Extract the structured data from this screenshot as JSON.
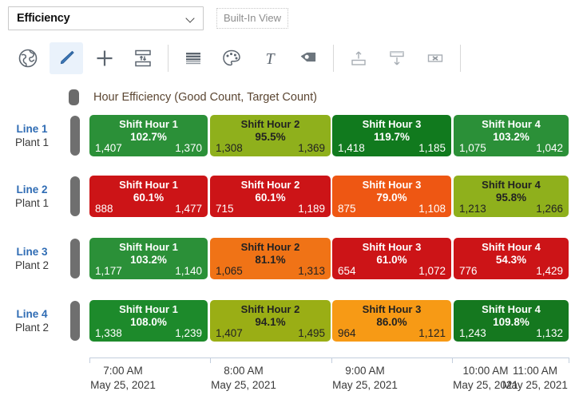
{
  "header": {
    "view_select_value": "Efficiency",
    "view_select_icon": "chevron-down-icon",
    "builtin_view_label": "Built-In View"
  },
  "toolbar": {
    "items": [
      {
        "name": "globe-icon",
        "active": false
      },
      {
        "name": "pencil-icon",
        "active": true
      },
      {
        "name": "plus-icon",
        "active": false
      },
      {
        "name": "fit-rows-icon",
        "active": false
      },
      {
        "name": "rows-icon",
        "active": false
      },
      {
        "name": "palette-icon",
        "active": false
      },
      {
        "name": "text-icon",
        "active": false
      },
      {
        "name": "tag-icon",
        "active": false
      },
      {
        "name": "export-up-icon",
        "active": false
      },
      {
        "name": "import-down-icon",
        "active": false
      },
      {
        "name": "delete-view-icon",
        "active": false
      }
    ]
  },
  "legend": {
    "swatch_color": "#6b6b6b",
    "label": "Hour Efficiency (Good Count, Target Count)"
  },
  "chart_data": {
    "type": "heatmap",
    "title": "Hour Efficiency (Good Count, Target Count)",
    "xlabel": "",
    "ylabel": "",
    "grid": false,
    "legend_position": "top-left",
    "categories": [
      "Shift Hour 1",
      "Shift Hour 2",
      "Shift Hour 3",
      "Shift Hour 4"
    ],
    "x_ticks": [
      {
        "time": "7:00 AM",
        "date": "May 25, 2021"
      },
      {
        "time": "8:00 AM",
        "date": "May 25, 2021"
      },
      {
        "time": "9:00 AM",
        "date": "May 25, 2021"
      },
      {
        "time": "10:00 AM",
        "date": "May 25, 2021"
      },
      {
        "time": "11:00 AM",
        "date": "May 25, 2021"
      }
    ],
    "rows": [
      {
        "line": "Line 1",
        "plant": "Plant 1",
        "cells": [
          {
            "title": "Shift Hour 1",
            "pct": "102.7%",
            "good": "1,407",
            "target": "1,370",
            "color": "#2b9038",
            "text": "light"
          },
          {
            "title": "Shift Hour 2",
            "pct": "95.5%",
            "good": "1,308",
            "target": "1,369",
            "color": "#8fb01c",
            "text": "dark"
          },
          {
            "title": "Shift Hour 3",
            "pct": "119.7%",
            "good": "1,418",
            "target": "1,185",
            "color": "#117a1e",
            "text": "light"
          },
          {
            "title": "Shift Hour 4",
            "pct": "103.2%",
            "good": "1,075",
            "target": "1,042",
            "color": "#2b9038",
            "text": "light"
          }
        ]
      },
      {
        "line": "Line 2",
        "plant": "Plant 1",
        "cells": [
          {
            "title": "Shift Hour 1",
            "pct": "60.1%",
            "good": "888",
            "target": "1,477",
            "color": "#cc1417",
            "text": "light"
          },
          {
            "title": "Shift Hour 2",
            "pct": "60.1%",
            "good": "715",
            "target": "1,189",
            "color": "#cc1417",
            "text": "light"
          },
          {
            "title": "Shift Hour 3",
            "pct": "79.0%",
            "good": "875",
            "target": "1,108",
            "color": "#ee5713",
            "text": "light"
          },
          {
            "title": "Shift Hour 4",
            "pct": "95.8%",
            "good": "1,213",
            "target": "1,266",
            "color": "#8fb01c",
            "text": "dark"
          }
        ]
      },
      {
        "line": "Line 3",
        "plant": "Plant 2",
        "cells": [
          {
            "title": "Shift Hour 1",
            "pct": "103.2%",
            "good": "1,177",
            "target": "1,140",
            "color": "#2b9038",
            "text": "light"
          },
          {
            "title": "Shift Hour 2",
            "pct": "81.1%",
            "good": "1,065",
            "target": "1,313",
            "color": "#f07316",
            "text": "dark"
          },
          {
            "title": "Shift Hour 3",
            "pct": "61.0%",
            "good": "654",
            "target": "1,072",
            "color": "#cc1417",
            "text": "light"
          },
          {
            "title": "Shift Hour 4",
            "pct": "54.3%",
            "good": "776",
            "target": "1,429",
            "color": "#cc1417",
            "text": "light"
          }
        ]
      },
      {
        "line": "Line 4",
        "plant": "Plant 2",
        "cells": [
          {
            "title": "Shift Hour 1",
            "pct": "108.0%",
            "good": "1,338",
            "target": "1,239",
            "color": "#1d8a2b",
            "text": "light"
          },
          {
            "title": "Shift Hour 2",
            "pct": "94.1%",
            "good": "1,407",
            "target": "1,495",
            "color": "#9aae15",
            "text": "dark"
          },
          {
            "title": "Shift Hour 3",
            "pct": "86.0%",
            "good": "964",
            "target": "1,121",
            "color": "#f79a15",
            "text": "dark"
          },
          {
            "title": "Shift Hour 4",
            "pct": "109.8%",
            "good": "1,243",
            "target": "1,132",
            "color": "#15781f",
            "text": "light"
          }
        ]
      }
    ]
  }
}
